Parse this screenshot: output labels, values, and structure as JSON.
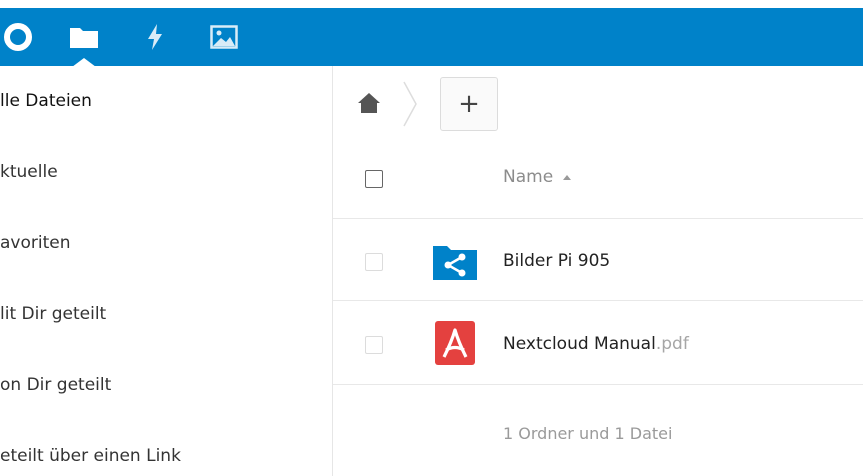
{
  "colors": {
    "header_blue": "#0082c9",
    "shared_folder_blue": "#0082c9",
    "pdf_red": "#e4413f"
  },
  "header": {
    "apps": [
      {
        "name": "logo",
        "icon": "nextcloud-logo-icon"
      },
      {
        "name": "files",
        "icon": "folder-icon",
        "active": true
      },
      {
        "name": "activity",
        "icon": "lightning-icon"
      },
      {
        "name": "gallery",
        "icon": "image-icon"
      }
    ]
  },
  "sidebar": {
    "items": [
      {
        "label": "lle Dateien",
        "active": true
      },
      {
        "label": "ktuelle"
      },
      {
        "label": "avoriten"
      },
      {
        "label": "lit Dir geteilt"
      },
      {
        "label": "on Dir geteilt"
      },
      {
        "label": "eteilt über einen Link"
      }
    ]
  },
  "breadcrumb": {
    "home_icon": "home-icon",
    "new_label": "+"
  },
  "files_table": {
    "columns": {
      "name": "Name"
    },
    "sort": "ascending",
    "rows": [
      {
        "icon": "shared-folder-icon",
        "name": "Bilder Pi 905",
        "ext": ""
      },
      {
        "icon": "pdf-file-icon",
        "name": "Nextcloud Manual",
        "ext": ".pdf"
      }
    ],
    "summary": "1 Ordner und 1 Datei"
  }
}
